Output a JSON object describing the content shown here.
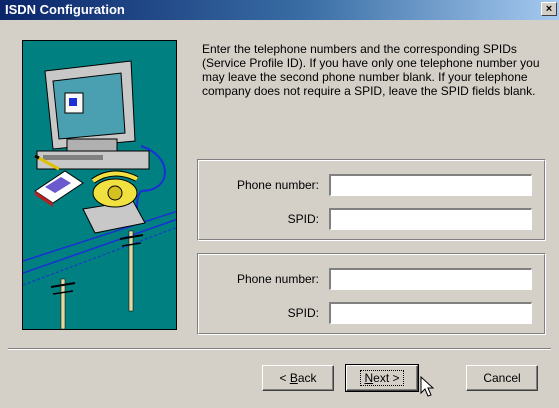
{
  "window": {
    "title": "ISDN Configuration",
    "close_label": "×"
  },
  "instructions": "Enter the telephone numbers and the corresponding SPIDs (Service Profile ID).  If you have only one telephone number you may leave the second phone number blank.  If your telephone company does not require a SPID, leave the SPID fields blank.",
  "line1": {
    "phone_label": "Phone number:",
    "phone_value": "",
    "spid_label": "SPID:",
    "spid_value": ""
  },
  "line2": {
    "phone_label": "Phone number:",
    "phone_value": "",
    "spid_label": "SPID:",
    "spid_value": ""
  },
  "buttons": {
    "back": {
      "pre": "< ",
      "mnemonic": "B",
      "post": "ack"
    },
    "next": {
      "mnemonic": "N",
      "post": "ext >"
    },
    "cancel": "Cancel"
  },
  "colors": {
    "illustration_bg": "#008080",
    "titlebar": "#0a246a",
    "face": "#d4d0c8"
  },
  "icons": [
    "computer-icon",
    "telephone-icon",
    "notepad-icon",
    "pencil-icon",
    "telephone-pole-icon",
    "pointer-cursor-icon"
  ]
}
